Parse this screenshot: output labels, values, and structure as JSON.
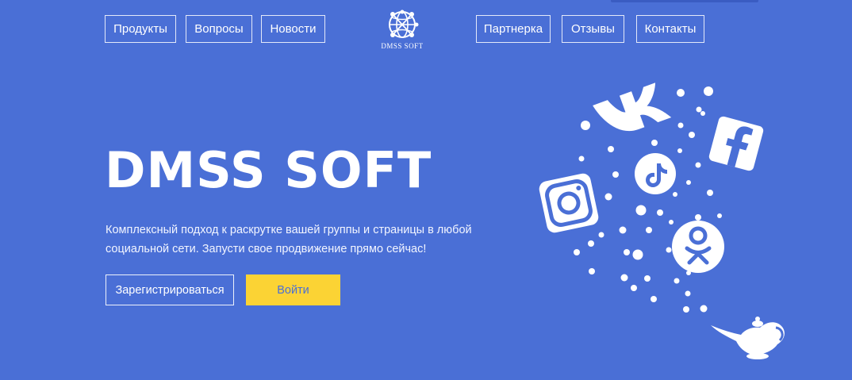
{
  "nav": {
    "left": [
      "Продукты",
      "Вопросы",
      "Новости"
    ],
    "right": [
      "Партнерка",
      "Отзывы",
      "Контакты"
    ]
  },
  "logo": {
    "text": "DMSS SOFT",
    "icon": "globe-network-icon"
  },
  "hero": {
    "title": "DMSS SOFT",
    "description": "Комплексный подход к раскрутке вашей группы и страницы в любой социальной сети. Запусти свое продвижение прямо сейчас!",
    "register_label": "Зарегистрироваться",
    "login_label": "Войти"
  },
  "illustration": {
    "icons": [
      "vk-icon",
      "facebook-icon",
      "tiktok-icon",
      "instagram-icon",
      "odnoklassniki-icon",
      "magic-lamp-icon"
    ]
  },
  "colors": {
    "background": "#4a6fd6",
    "accent": "#fbd334",
    "text": "#ffffff"
  }
}
